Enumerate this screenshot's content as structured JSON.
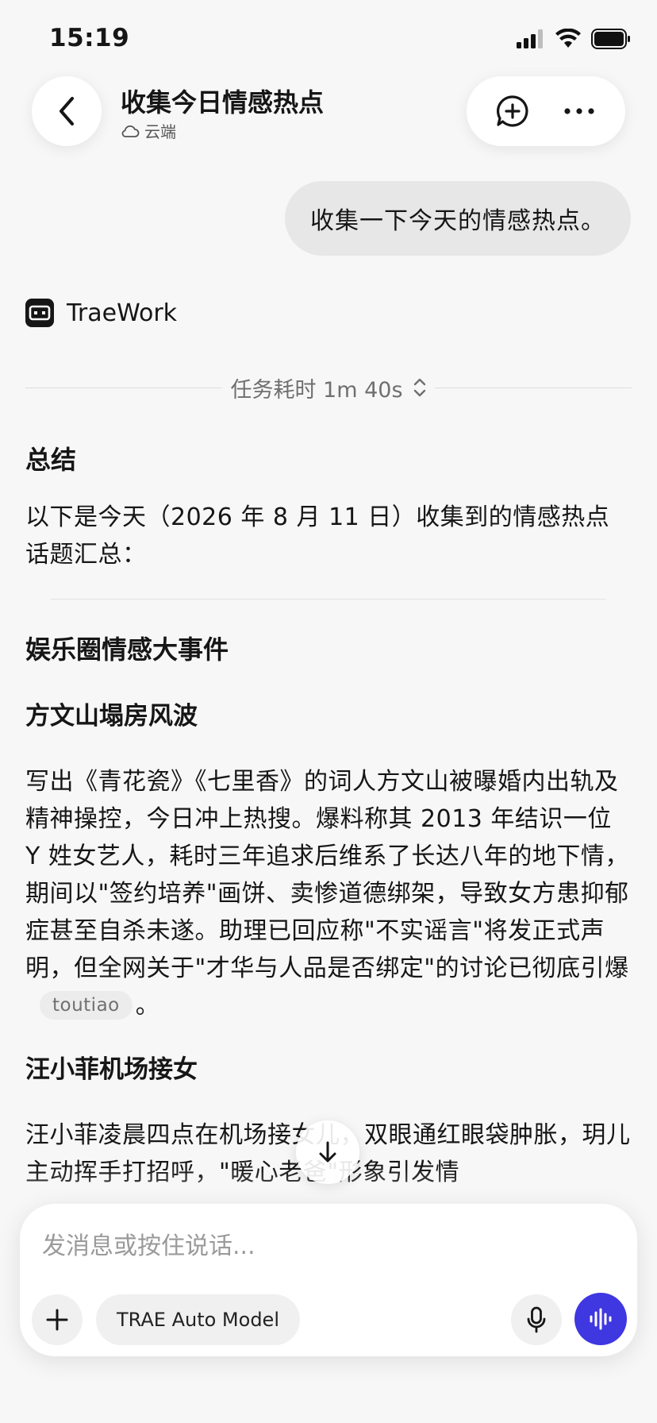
{
  "status_bar": {
    "time": "15:19"
  },
  "header": {
    "title": "收集今日情感热点",
    "subtitle": "云端",
    "icons": {
      "back": "chevron-left-icon",
      "new_chat": "add-message-icon",
      "more": "more-horizontal-icon",
      "cloud": "cloud-icon"
    }
  },
  "conversation": {
    "user_message": "收集一下今天的情感热点。",
    "bot_name": "TraeWork",
    "duration_label": "任务耗时 1m 40s",
    "summary_heading": "总结",
    "intro": "以下是今天（2026 年 8 月 11 日）收集到的情感热点话题汇总：",
    "section_heading": "娱乐圈情感大事件",
    "items": [
      {
        "title": "方文山塌房风波",
        "body": "写出《青花瓷》《七里香》的词人方文山被曝婚内出轨及精神操控，今日冲上热搜。爆料称其 2013 年结识一位 Y 姓女艺人，耗时三年追求后维系了长达八年的地下情，期间以\"签约培养\"画饼、卖惨道德绑架，导致女方患抑郁症甚至自杀未遂。助理已回应称\"不实谣言\"将发正式声明，但全网关于\"才华与人品是否绑定\"的讨论已彻底引爆",
        "source": "toutiao",
        "tail": "。"
      },
      {
        "title": "汪小菲机场接女",
        "body": "汪小菲凌晨四点在机场接女儿，双眼通红眼袋肿胀，玥儿主动挥手打招呼，\"暖心老爸\"形象引发情"
      }
    ]
  },
  "composer": {
    "placeholder": "发消息或按住说话...",
    "model_label": "TRAE Auto Model"
  },
  "colors": {
    "accent": "#3f37e0",
    "background": "#f7f7f7",
    "bubble": "#e7e7e7"
  }
}
